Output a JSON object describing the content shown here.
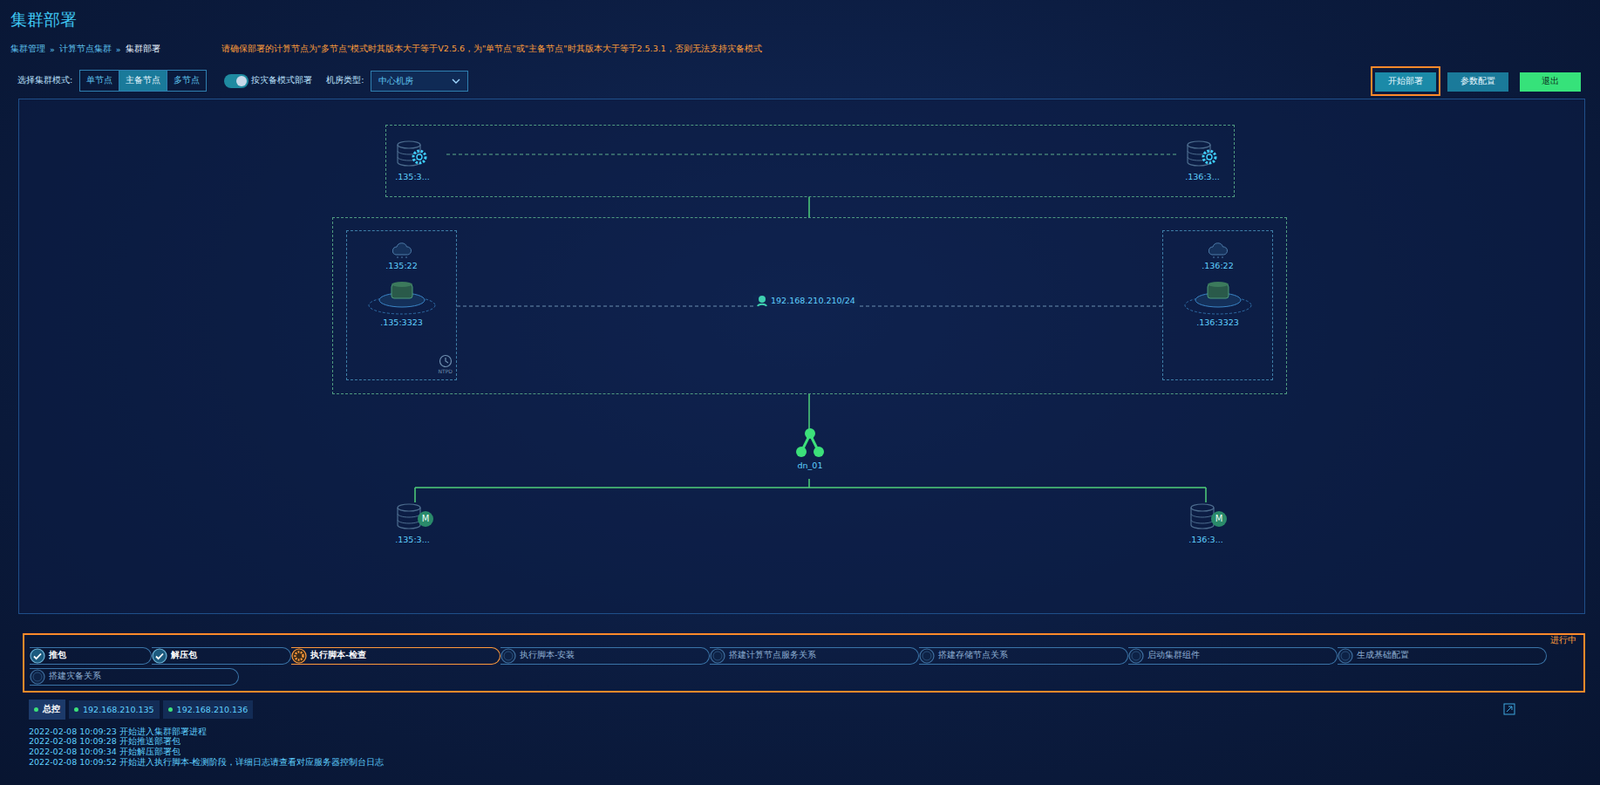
{
  "page": {
    "title": "集群部署"
  },
  "breadcrumb": {
    "separator": "»",
    "items": [
      "集群管理",
      "计算节点集群",
      "集群部署"
    ]
  },
  "notice": "请确保部署的计算节点为\"多节点\"模式时其版本大于等于V2.5.6，为\"单节点\"或\"主备节点\"时其版本大于等于2.5.3.1，否则无法支持灾备模式",
  "toolbar": {
    "mode_label": "选择集群模式:",
    "modes": [
      {
        "label": "单节点",
        "selected": false
      },
      {
        "label": "主备节点",
        "selected": true
      },
      {
        "label": "多节点",
        "selected": false
      }
    ],
    "dr_toggle": {
      "label": "按灾备模式部署",
      "on": true
    },
    "room_label": "机房类型:",
    "room_select": {
      "value": "中心机房"
    }
  },
  "actions": [
    {
      "label": "开始部署",
      "kind": "primary",
      "highlighted": true
    },
    {
      "label": "参数配置",
      "kind": "secondary",
      "highlighted": false
    },
    {
      "label": "退出",
      "kind": "exit",
      "highlighted": false
    }
  ],
  "diagram": {
    "config_nodes": [
      {
        "label": ".135:3..."
      },
      {
        "label": ".136:3..."
      }
    ],
    "compute_nodes": [
      {
        "ssh": ".135:22",
        "port": ".135:3323",
        "ntpd": true
      },
      {
        "ssh": ".136:22",
        "port": ".136:3323",
        "ntpd": false
      }
    ],
    "ntpd_label": "NTPD",
    "vip": "192.168.210.210/24",
    "datanode": "dn_01",
    "storage_nodes": [
      {
        "label": ".135:3...",
        "badge": "M"
      },
      {
        "label": ".136:3...",
        "badge": "M"
      }
    ]
  },
  "progress": {
    "status": "进行中",
    "steps": [
      {
        "label": "推包",
        "state": "done"
      },
      {
        "label": "解压包",
        "state": "done"
      },
      {
        "label": "执行脚本-检查",
        "state": "running"
      },
      {
        "label": "执行脚本-安装",
        "state": "pending"
      },
      {
        "label": "搭建计算节点服务关系",
        "state": "pending"
      },
      {
        "label": "搭建存储节点关系",
        "state": "pending"
      },
      {
        "label": "启动集群组件",
        "state": "pending"
      },
      {
        "label": "生成基础配置",
        "state": "pending"
      },
      {
        "label": "搭建灾备关系",
        "state": "pending"
      }
    ]
  },
  "log_tabs": [
    {
      "label": "总控",
      "selected": true
    },
    {
      "label": "192.168.210.135",
      "selected": false
    },
    {
      "label": "192.168.210.136",
      "selected": false
    }
  ],
  "logs": [
    "2022-02-08 10:09:23 开始进入集群部署进程",
    "2022-02-08 10:09:28 开始推送部署包",
    "2022-02-08 10:09:34 开始解压部署包",
    "2022-02-08 10:09:52 开始进入执行脚本-检测阶段，详细日志请查看对应服务器控制台日志"
  ]
}
